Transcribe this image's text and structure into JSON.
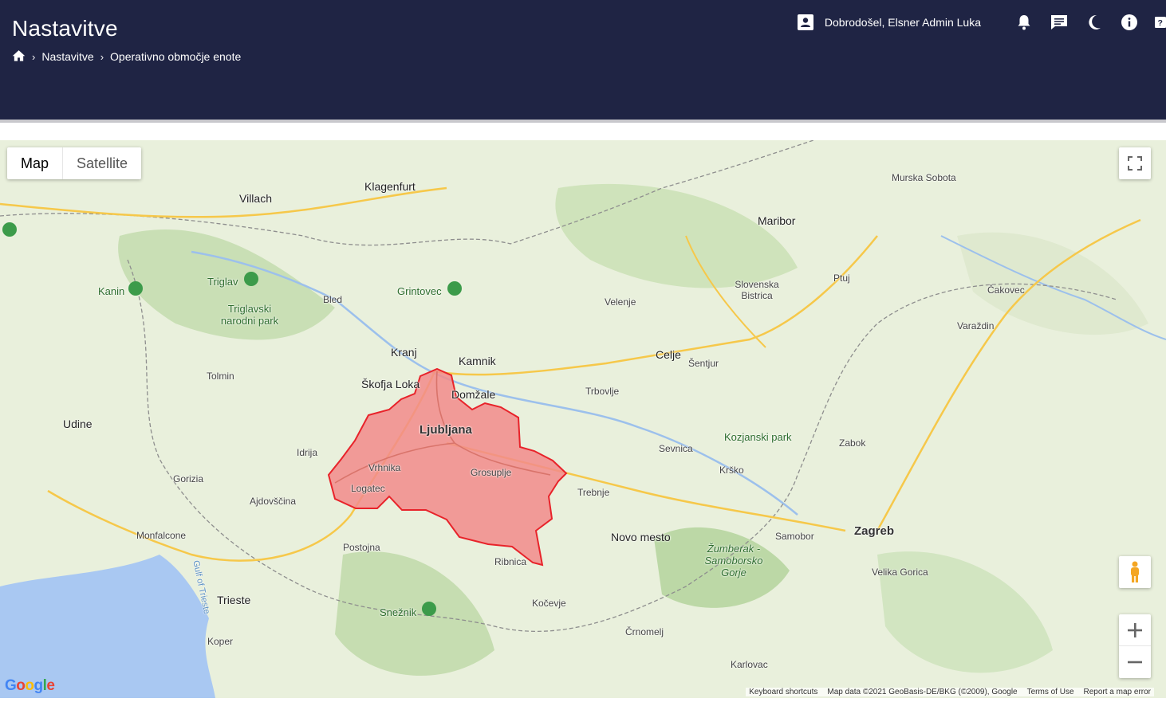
{
  "header": {
    "title": "Nastavitve",
    "breadcrumb": [
      "Nastavitve",
      "Operativno območje enote"
    ],
    "user_greeting": "Dobrodošel, Elsner Admin Luka"
  },
  "map": {
    "type_buttons": [
      "Map",
      "Satellite"
    ],
    "selected_type": "Map",
    "labels": {
      "ljubljana": "Ljubljana",
      "vrhnika": "Vrhnika",
      "logatec": "Logatec",
      "grosuplje": "Grosuplje",
      "domzale": "Domžale",
      "skofja_loka": "Škofja Loka",
      "kranj": "Kranj",
      "kamnik": "Kamnik",
      "celje": "Celje",
      "maribor": "Maribor",
      "zagreb": "Zagreb",
      "novo_mesto": "Novo mesto",
      "trieste": "Trieste",
      "udine": "Udine",
      "villach": "Villach",
      "klagenfurt": "Klagenfurt",
      "murska_sobota": "Murska Sobota",
      "varazdin": "Varaždin",
      "krsko": "Krško",
      "trbovlje": "Trbovlje",
      "velenje": "Velenje",
      "kocevje": "Kočevje",
      "koper": "Koper",
      "postojna": "Postojna",
      "triglav_park": "Triglavski narodni park",
      "kozjanski_park": "Kozjanski park",
      "snežnik": "Snežnik",
      "triglav": "Triglav",
      "kanin": "Kanin",
      "grintovec": "Grintovec",
      "karlovac": "Karlovac",
      "ptuj": "Ptuj",
      "cakovec": "Čakovec",
      "gorizia": "Gorizia",
      "ajdovscina": "Ajdovščina",
      "ribnica": "Ribnica",
      "trebnje": "Trebnje",
      "sevnica": "Sevnica",
      "idrija": "Idrija",
      "zabok": "Zabok",
      "velika_gorica": "Velika Gorica",
      "samobor": "Samobor",
      "crnomelj": "Črnomelj",
      "monfalcone": "Monfalcone",
      "slovenska_bistrica": "Slovenska Bistrica",
      "sentjur": "Šentjur",
      "zumberak": "Žumberak - Samoborsko Gorje",
      "gulf": "Gulf of Trieste",
      "bled": "Bled",
      "tolmin": "Tolmin"
    },
    "footer": {
      "shortcuts": "Keyboard shortcuts",
      "data": "Map data ©2021 GeoBasis-DE/BKG (©2009), Google",
      "terms": "Terms of Use",
      "report": "Report a map error"
    },
    "logo": "Google",
    "region_color": "#f28b8b",
    "region_border": "#e8232a"
  }
}
